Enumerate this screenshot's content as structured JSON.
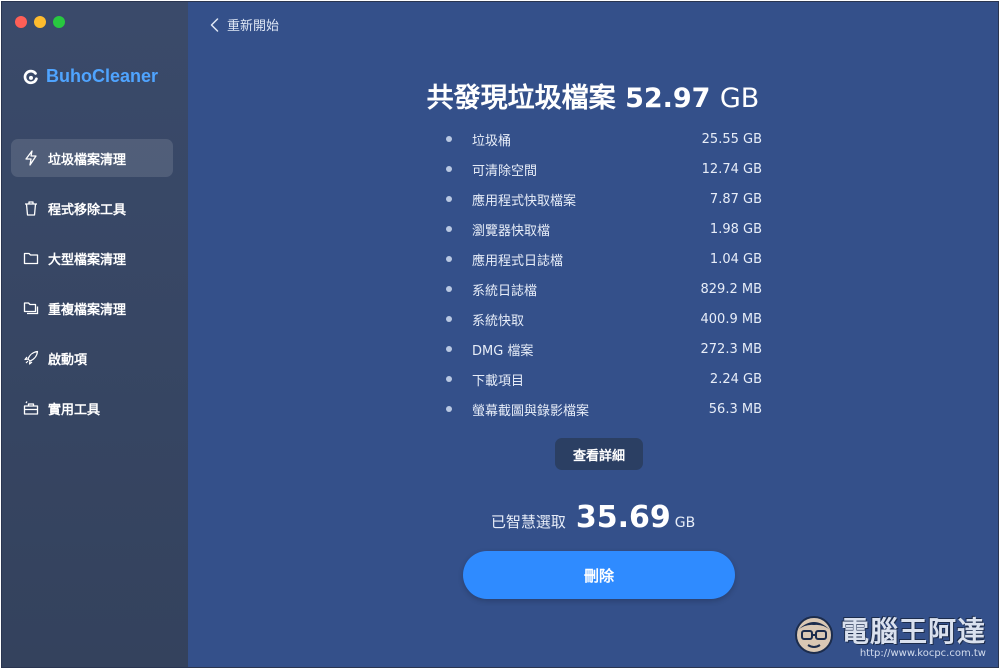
{
  "app": {
    "brand": "BuhoCleaner"
  },
  "sidebar": {
    "items": [
      {
        "label": "垃圾檔案清理",
        "icon": "bolt-icon",
        "active": true
      },
      {
        "label": "程式移除工具",
        "icon": "trash-icon",
        "active": false
      },
      {
        "label": "大型檔案清理",
        "icon": "folder-icon",
        "active": false
      },
      {
        "label": "重複檔案清理",
        "icon": "duplicate-folder-icon",
        "active": false
      },
      {
        "label": "啟動項",
        "icon": "rocket-icon",
        "active": false
      },
      {
        "label": "實用工具",
        "icon": "toolbox-icon",
        "active": false
      }
    ]
  },
  "header": {
    "back_label": "重新開始"
  },
  "main": {
    "title_prefix": "共發現垃圾檔案",
    "title_value": "52.97",
    "title_unit": "GB",
    "items": [
      {
        "name": "垃圾桶",
        "size": "25.55 GB"
      },
      {
        "name": "可清除空間",
        "size": "12.74 GB"
      },
      {
        "name": "應用程式快取檔案",
        "size": "7.87 GB"
      },
      {
        "name": "瀏覽器快取檔",
        "size": "1.98 GB"
      },
      {
        "name": "應用程式日誌檔",
        "size": "1.04 GB"
      },
      {
        "name": "系統日誌檔",
        "size": "829.2 MB"
      },
      {
        "name": "系統快取",
        "size": "400.9 MB"
      },
      {
        "name": "DMG 檔案",
        "size": "272.3 MB"
      },
      {
        "name": "下載項目",
        "size": "2.24 GB"
      },
      {
        "name": "螢幕截圖與錄影檔案",
        "size": "56.3 MB"
      }
    ],
    "details_label": "查看詳細",
    "smart_label": "已智慧選取",
    "smart_value": "35.69",
    "smart_unit": "GB",
    "delete_label": "刪除"
  },
  "watermark": {
    "text": "電腦王阿達",
    "url": "http://www.kocpc.com.tw"
  },
  "colors": {
    "sidebar_bg": "#3a4a6a",
    "main_bg": "#34508a",
    "accent": "#2f8bff",
    "brand": "#4fa4ff"
  }
}
